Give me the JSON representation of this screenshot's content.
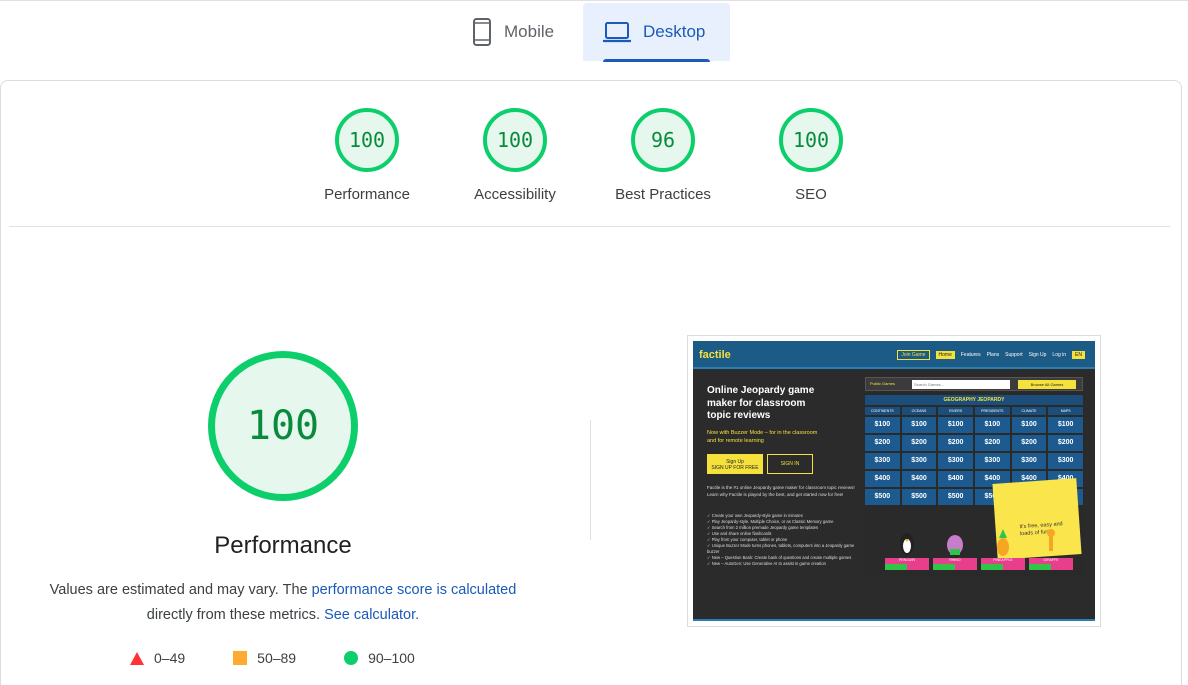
{
  "tabs": {
    "mobile_label": "Mobile",
    "desktop_label": "Desktop",
    "active": "Desktop"
  },
  "scores": [
    {
      "value": "100",
      "label": "Performance"
    },
    {
      "value": "100",
      "label": "Accessibility"
    },
    {
      "value": "96",
      "label": "Best Practices"
    },
    {
      "value": "100",
      "label": "SEO"
    }
  ],
  "performance": {
    "score": "100",
    "title": "Performance",
    "desc_prefix": "Values are estimated and may vary. The ",
    "desc_link1": "performance score is calculated",
    "desc_middle": " directly from these metrics. ",
    "desc_link2": "See calculator.",
    "legend": [
      {
        "range": "0–49",
        "shape": "triangle",
        "color": "#ff3333"
      },
      {
        "range": "50–89",
        "shape": "square",
        "color": "#ffaa33"
      },
      {
        "range": "90–100",
        "shape": "circle",
        "color": "#0cce6b"
      }
    ]
  },
  "colors": {
    "pass_green": "#0cce6b",
    "pass_text": "#0a8a3c",
    "link_blue": "#1a5ab8"
  },
  "screenshot": {
    "logo": "factile",
    "nav": {
      "join": "Join Game",
      "home": "Home",
      "features": "Features",
      "plans": "Plans",
      "support": "Support",
      "signup": "Sign Up",
      "login": "Log in",
      "lang": "EN"
    },
    "headline": "Online Jeopardy game maker for classroom topic reviews",
    "sub": "Now with Buzzer Mode – for in the classroom and for remote learning",
    "btn_signup": "Sign Up",
    "btn_signup_sub": "SIGN UP FOR FREE",
    "btn_signin": "SIGN IN",
    "para": "Factile is the #1 online Jeopardy game maker for classroom topic reviews! Learn why Factile is played by the best, and get started now for free!",
    "features": [
      "Create your own Jeopardy-style game in minutes",
      "Play Jeopardy-style, Multiple Choice, or as Classic Memory game",
      "Search from 2 million premade Jeopardy game templates",
      "Use and share online flashcards",
      "Play from your computer, tablet or phone",
      "Unique Buzzer Mode turns phones, tablets, computers into a Jeopardy game buzzer",
      "New – Question Bank: Create bank of questions and create multiple games",
      "New – AutoGen: Use Generative AI to assist in game creation"
    ],
    "public_games": "Public Games",
    "search_placeholder": "Search Games...",
    "browse": "Browse All Games",
    "board_title": "GEOGRAPHY JEOPARDY",
    "categories": [
      "CONTINENTS",
      "OCEANS",
      "RIVERS",
      "PRESIDENTS",
      "CLIMATE",
      "MAPS"
    ],
    "values": [
      "$100",
      "$200",
      "$300",
      "$400",
      "$500"
    ],
    "note": "It's free, easy and loads of fun!",
    "play_demo": "Play Demo Game",
    "players": [
      "PENGUIN",
      "RHINO",
      "PINEAPPLE",
      "GIRAFFE"
    ],
    "player_score": "60"
  }
}
